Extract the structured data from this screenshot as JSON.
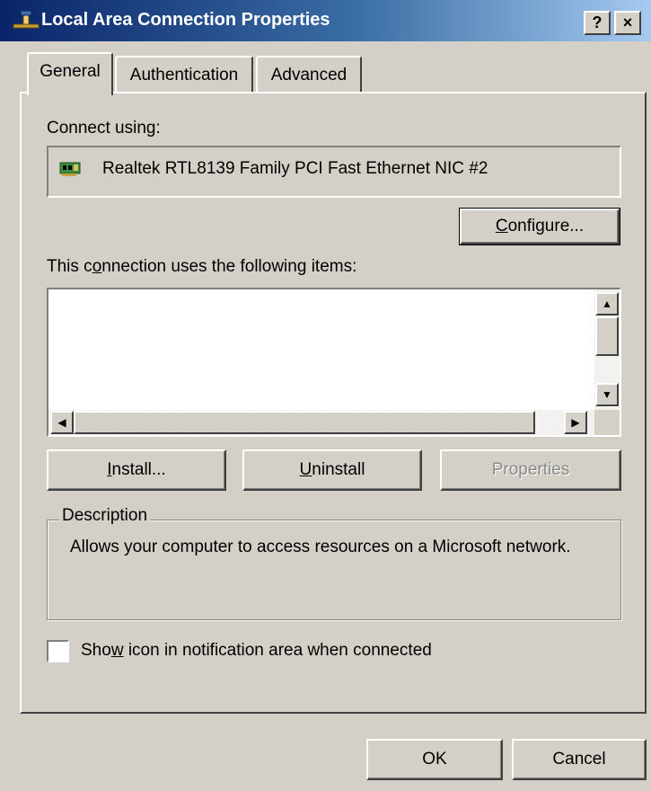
{
  "window": {
    "title": "Local Area Connection Properties",
    "help_label": "?",
    "close_label": "×"
  },
  "tabs": [
    {
      "label": "General",
      "active": true
    },
    {
      "label": "Authentication",
      "active": false
    },
    {
      "label": "Advanced",
      "active": false
    }
  ],
  "general": {
    "connect_using_label": "Connect using:",
    "adapter_name": "Realtek RTL8139 Family PCI Fast Ethernet NIC #2",
    "configure_button": {
      "mnemonic": "C",
      "rest": "onfigure..."
    },
    "items_label": {
      "before": "This c",
      "mnemonic": "o",
      "after": "nnection uses the following items:"
    },
    "items_list": [],
    "install_button": {
      "before": "",
      "mnemonic": "I",
      "after": "nstall..."
    },
    "uninstall_button": {
      "before": "",
      "mnemonic": "U",
      "after": "ninstall"
    },
    "properties_button": {
      "label": "Properties",
      "disabled": true
    },
    "description_title": "Description",
    "description_text": "Allows your computer to access resources on a Microsoft network.",
    "show_icon_checkbox": {
      "before": "Sho",
      "mnemonic": "w",
      "after": " icon in notification area when connected",
      "checked": false
    }
  },
  "footer": {
    "ok_label": "OK",
    "cancel_label": "Cancel"
  },
  "colors": {
    "titlebar_start": "#0a246a",
    "titlebar_end": "#a6caf0",
    "face": "#d4d0c8"
  },
  "icons": {
    "title": "network-connection-icon",
    "adapter": "network-card-icon"
  }
}
